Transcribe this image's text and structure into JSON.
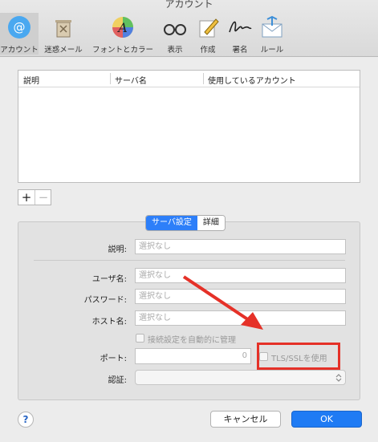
{
  "window": {
    "title": "アカウント"
  },
  "toolbar": {
    "items": [
      {
        "label": "アカウント",
        "icon": "at-sign-icon",
        "active": true
      },
      {
        "label": "迷惑メール",
        "icon": "trash-icon"
      },
      {
        "label": "フォントとカラー",
        "icon": "font-color-icon"
      },
      {
        "label": "表示",
        "icon": "glasses-icon"
      },
      {
        "label": "作成",
        "icon": "pencil-note-icon"
      },
      {
        "label": "署名",
        "icon": "signature-icon"
      },
      {
        "label": "ルール",
        "icon": "rules-envelope-icon"
      }
    ]
  },
  "accounts_table": {
    "headers": [
      "説明",
      "サーバ名",
      "使用しているアカウント"
    ],
    "rows": []
  },
  "add_remove": {
    "add": "+",
    "remove": "−"
  },
  "tabs": {
    "items": [
      "サーバ設定",
      "詳細"
    ],
    "selected": "サーバ設定"
  },
  "form": {
    "description": {
      "label": "説明:",
      "placeholder": "選択なし"
    },
    "username": {
      "label": "ユーザ名:",
      "placeholder": "選択なし"
    },
    "password": {
      "label": "パスワード:",
      "placeholder": "選択なし"
    },
    "host": {
      "label": "ホスト名:",
      "placeholder": "選択なし"
    },
    "auto_manage": {
      "label": "接続設定を自動的に管理",
      "checked": false
    },
    "port": {
      "label": "ポート:",
      "value": "0"
    },
    "tls": {
      "label": "TLS/SSLを使用",
      "checked": false
    },
    "auth": {
      "label": "認証:",
      "value": ""
    }
  },
  "footer": {
    "help": "?",
    "cancel": "キャンセル",
    "ok": "OK"
  },
  "colors": {
    "accent": "#2d7ff9",
    "annotation": "#e53128"
  }
}
